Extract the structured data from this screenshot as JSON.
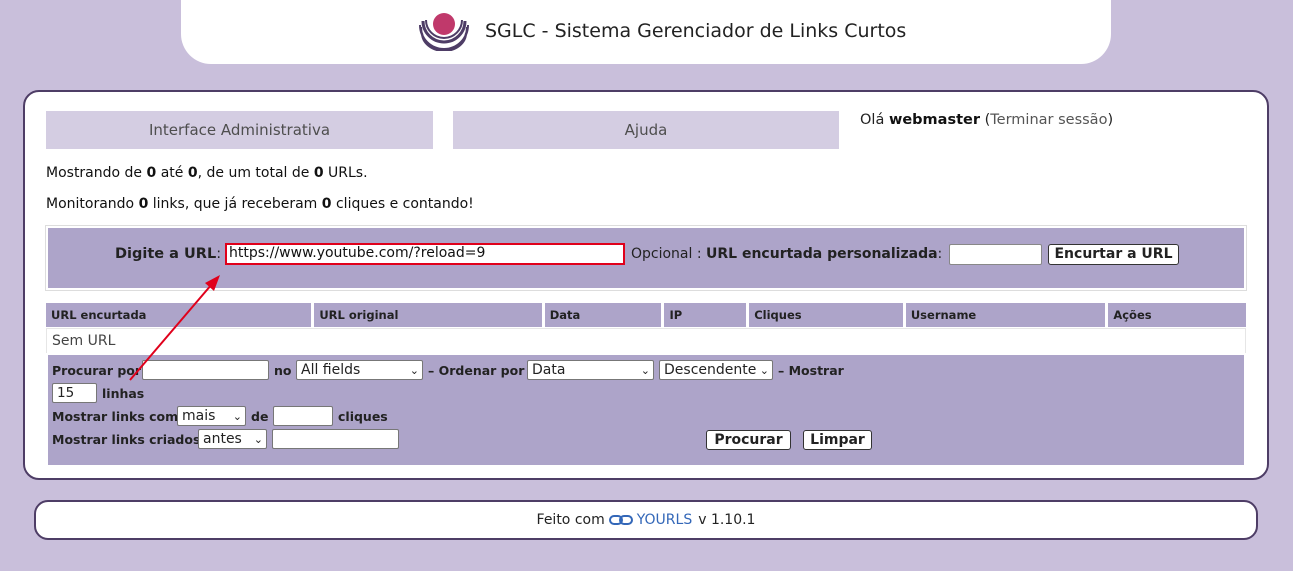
{
  "header": {
    "title": "SGLC - Sistema Gerenciador de Links Curtos",
    "logo_icon": "university-logo-icon"
  },
  "nav": {
    "admin_label": "Interface Administrativa",
    "help_label": "Ajuda"
  },
  "greeting": {
    "prefix": "Olá ",
    "user": "webmaster",
    "open_paren": " (",
    "logout_label": "Terminar sessão",
    "close_paren": ")"
  },
  "stats": {
    "showing_prefix": "Mostrando de ",
    "from": "0",
    "to_word": " até ",
    "to": "0",
    "total_word": ", de um total de ",
    "total": "0",
    "urls_word": " URLs.",
    "monitor_prefix": "Monitorando ",
    "links": "0",
    "links_word": " links, que já receberam ",
    "clicks": "0",
    "clicks_word": " cliques e contando!"
  },
  "add_url": {
    "label": "Digite a URL",
    "colon": ":",
    "url_value": "https://www.youtube.com/?reload=9",
    "optional_label": "Opcional",
    "colon2": " : ",
    "custom_label": "URL encurtada personalizada",
    "colon3": ":",
    "custom_value": "",
    "submit_label": "Encurtar a URL"
  },
  "table": {
    "headers": [
      "URL encurtada",
      "URL original",
      "Data",
      "IP",
      "Cliques",
      "Username",
      "Ações"
    ],
    "empty_text": "Sem URL"
  },
  "filters": {
    "search_label": "Procurar por",
    "search_value": "",
    "in_label": "no",
    "field_selected": "All fields",
    "order_label": "– Ordenar por",
    "order_selected": "Data",
    "direction_selected": "Descendente",
    "show_label": "– Mostrar",
    "rows_value": "15",
    "rows_label": "linhas",
    "clicks_filter_label": "Mostrar links com",
    "clicks_compare_selected": "mais",
    "of_label": "de",
    "clicks_value": "",
    "clicks_word": "cliques",
    "created_label": "Mostrar links criados",
    "created_compare_selected": "antes",
    "created_value": "",
    "search_button": "Procurar",
    "clear_button": "Limpar"
  },
  "footer": {
    "made_with": "Feito com",
    "link_icon": "chain-link-icon",
    "brand": "YOURLS",
    "version": "v 1.10.1"
  },
  "colors": {
    "background": "#c9bfdb",
    "panel_border": "#4e3d66",
    "box_fill": "#ada4c9",
    "nav_fill": "#d4cde2",
    "highlight_red": "#e0001b",
    "link_blue": "#3367b8"
  }
}
